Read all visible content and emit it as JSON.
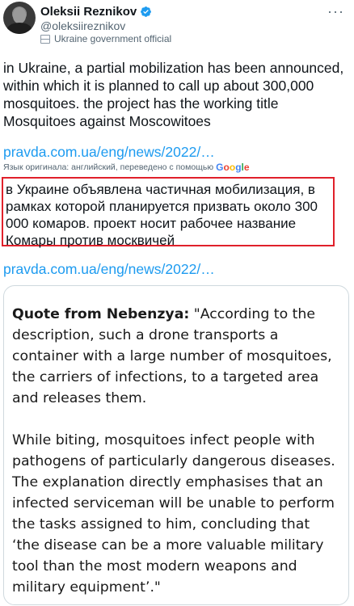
{
  "author": {
    "name": "Oleksii Reznikov",
    "handle": "@oleksiireznikov",
    "affiliation": "Ukraine government official"
  },
  "icons": {
    "more": "more-icon",
    "verified": "verified-badge-icon",
    "affiliation": "government-flag-icon"
  },
  "colors": {
    "link": "#1d9bf0",
    "verified": "#1d9bf0",
    "highlight_border": "#e0202a"
  },
  "tweet": {
    "text": "in Ukraine, a partial mobilization has been announced, within which it is planned to call up about 300,000 mosquitoes. the project has the working title Mosquitoes against Moscowitoes",
    "link1": "pravda.com.ua/eng/news/2022/…",
    "translation_note": "Язык оригинала: английский, переведено с помощью",
    "google": [
      "G",
      "o",
      "o",
      "g",
      "l",
      "e"
    ],
    "translated_text": "в Украине объявлена частичная мобилизация, в рамках которой планируется призвать около 300 000 комаров. проект носит рабочее название Комары против москвичей",
    "link2": "pravda.com.ua/eng/news/2022/…"
  },
  "card": {
    "quote_label": "Quote from Nebenzya:",
    "quote_p1": " \"According to the description, such a drone transports a container with a large number of mosquitoes, the carriers of infections, to a targeted area and releases them.",
    "quote_p2": "While biting, mosquitoes infect people with pathogens of particularly dangerous diseases. The explanation directly emphasises that an infected serviceman will be unable to perform the tasks assigned to him, concluding that ‘the disease can be a more valuable military tool than the most modern weapons and military equipment’.\""
  }
}
